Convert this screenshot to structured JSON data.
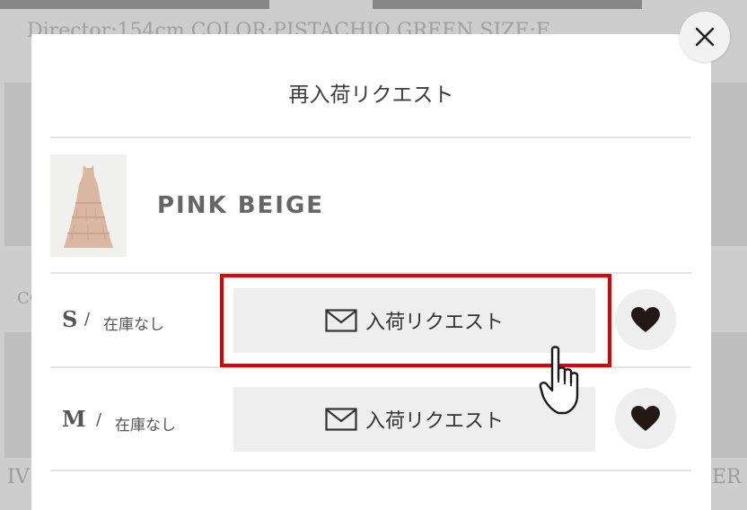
{
  "background": {
    "caption": "Director:154cm COLOR:PISTACHIO GREEN SIZE:F",
    "left_label": "CO",
    "bottom_left_label": "IV",
    "bottom_right_label": "ER"
  },
  "modal": {
    "title": "再入荷リクエスト",
    "product": {
      "color_name": "PINK BEIGE",
      "thumbnail_icon": "dress-thumbnail"
    },
    "sizes": [
      {
        "size": "S",
        "separator": "/",
        "stock": "在庫なし",
        "request_label": "入荷リクエスト",
        "mail_icon": "envelope-icon",
        "favorite_icon": "heart-icon"
      },
      {
        "size": "M",
        "separator": "/",
        "stock": "在庫なし",
        "request_label": "入荷リクエスト",
        "mail_icon": "envelope-icon",
        "favorite_icon": "heart-icon"
      }
    ],
    "close_icon": "close-icon"
  },
  "annotation": {
    "highlight_color": "#e00000",
    "pointer_icon": "hand-pointer-icon"
  },
  "colors": {
    "button_bg": "#eeeeee",
    "heart": "#231816",
    "divider": "#e3e3e3"
  }
}
